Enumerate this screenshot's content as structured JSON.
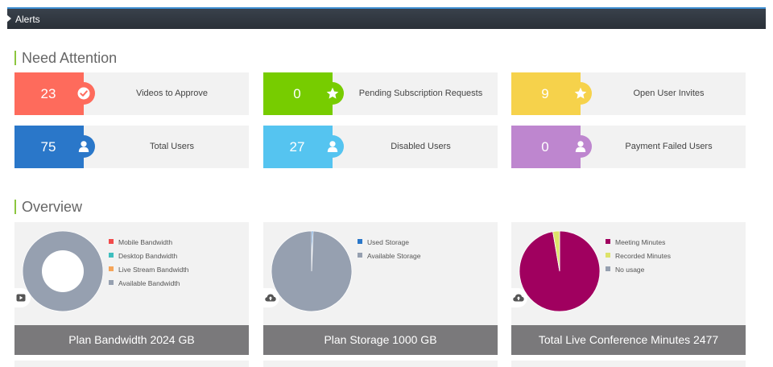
{
  "header": {
    "title": "Alerts"
  },
  "attention": {
    "title": "Need Attention",
    "cards": [
      {
        "count": "23",
        "label": "Videos to Approve",
        "color": "#fe6b5c",
        "icon": "check-circle-icon"
      },
      {
        "count": "0",
        "label": "Pending Subscription Requests",
        "color": "#77cc00",
        "icon": "star-icon"
      },
      {
        "count": "9",
        "label": "Open User Invites",
        "color": "#f6d24b",
        "icon": "star-icon"
      },
      {
        "count": "75",
        "label": "Total Users",
        "color": "#2a77c9",
        "icon": "user-icon"
      },
      {
        "count": "27",
        "label": "Disabled Users",
        "color": "#55c4f0",
        "icon": "user-icon"
      },
      {
        "count": "0",
        "label": "Payment Failed Users",
        "color": "#be86cf",
        "icon": "user-icon"
      }
    ]
  },
  "overview": {
    "title": "Overview",
    "panels": [
      {
        "footer": "Plan Bandwidth 2024 GB",
        "icon": "play-icon"
      },
      {
        "footer": "Plan Storage 1000 GB",
        "icon": "cloud-upload-icon"
      },
      {
        "footer": "Total Live Conference Minutes 2477",
        "icon": "cloud-upload-icon"
      }
    ]
  },
  "chart_data": [
    {
      "type": "pie",
      "variant": "donut",
      "legend_position": "right",
      "series": [
        {
          "name": "Mobile Bandwidth",
          "value": 0,
          "color": "#f24b4b"
        },
        {
          "name": "Desktop Bandwidth",
          "value": 0,
          "color": "#3fbfbf"
        },
        {
          "name": "Live Stream Bandwidth",
          "value": 0,
          "color": "#f5a55a"
        },
        {
          "name": "Available Bandwidth",
          "value": 100,
          "color": "#96a0b0"
        }
      ]
    },
    {
      "type": "pie",
      "legend_position": "right",
      "series": [
        {
          "name": "Used Storage",
          "value": 0.6,
          "color": "#2a77c9"
        },
        {
          "name": "Available Storage",
          "value": 99.4,
          "color": "#96a0b0"
        }
      ]
    },
    {
      "type": "pie",
      "legend_position": "right",
      "series": [
        {
          "name": "Meeting Minutes",
          "value": 97.3,
          "color": "#a0005f"
        },
        {
          "name": "Recorded Minutes",
          "value": 2.7,
          "color": "#dde36a"
        },
        {
          "name": "No usage",
          "value": 0,
          "color": "#96a0b0"
        }
      ]
    }
  ]
}
